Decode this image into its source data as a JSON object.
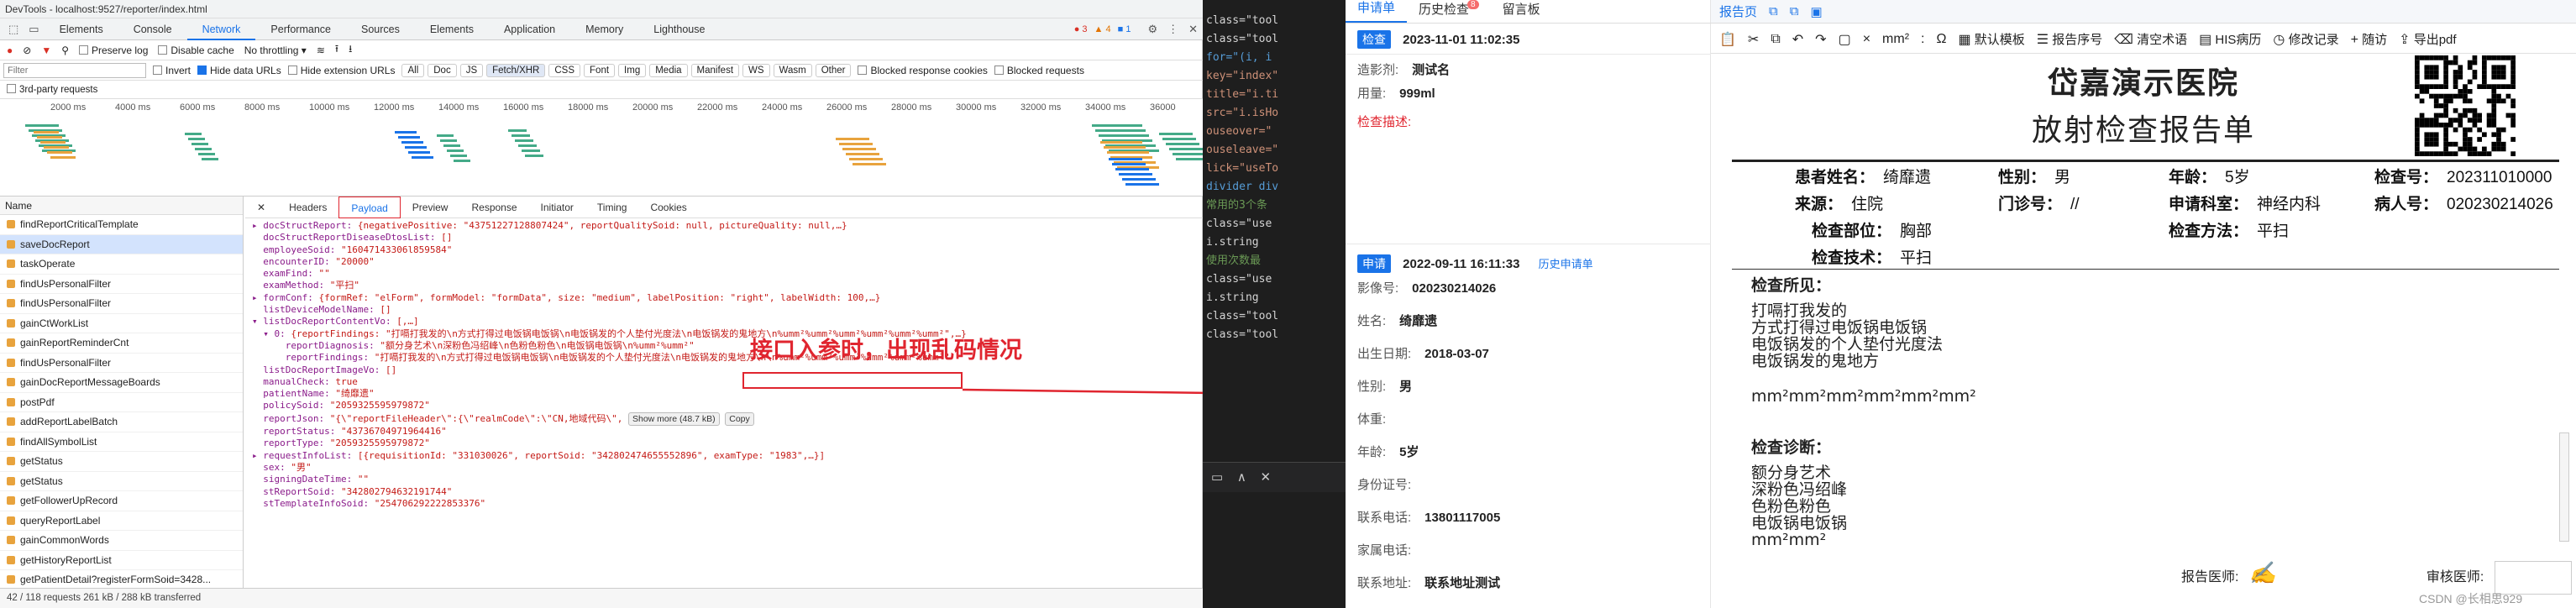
{
  "devtools": {
    "window_title": "DevTools - localhost:9527/reporter/index.html",
    "tabs": [
      "Elements",
      "Console",
      "Network",
      "Performance",
      "Sources",
      "Elements",
      "Application",
      "Memory",
      "Lighthouse"
    ],
    "active_tab": "Network",
    "badges": {
      "errors": "3",
      "warnings": "4",
      "info": "1"
    },
    "toolbar": {
      "preserve_log": "Preserve log",
      "disable_cache": "Disable cache",
      "throttling": "No throttling"
    },
    "filter": {
      "placeholder": "Filter",
      "invert": "Invert",
      "hide_data_urls": "Hide data URLs",
      "hide_ext_urls": "Hide extension URLs",
      "chips": [
        "All",
        "Doc",
        "JS",
        "Fetch/XHR",
        "CSS",
        "Font",
        "Img",
        "Media",
        "Manifest",
        "WS",
        "Wasm",
        "Other"
      ],
      "active_chip": "Fetch/XHR",
      "blocked_cookies": "Blocked response cookies",
      "blocked_requests": "Blocked requests"
    },
    "third_party": "3rd-party requests",
    "timeline_ticks": [
      "2000 ms",
      "4000 ms",
      "6000 ms",
      "8000 ms",
      "10000 ms",
      "12000 ms",
      "14000 ms",
      "16000 ms",
      "18000 ms",
      "20000 ms",
      "22000 ms",
      "24000 ms",
      "26000 ms",
      "28000 ms",
      "30000 ms",
      "32000 ms",
      "34000 ms",
      "36000"
    ],
    "req_header": "Name",
    "requests": [
      "findReportCriticalTemplate",
      "saveDocReport",
      "taskOperate",
      "findUsPersonalFilter",
      "findUsPersonalFilter",
      "gainCtWorkList",
      "gainReportReminderCnt",
      "findUsPersonalFilter",
      "gainDocReportMessageBoards",
      "postPdf",
      "addReportLabelBatch",
      "findAllSymbolList",
      "getStatus",
      "getStatus",
      "getFollowerUpRecord",
      "queryReportLabel",
      "gainCommonWords",
      "getHistoryReportList",
      "getPatientDetail?registerFormSoid=3428..."
    ],
    "selected_request": "saveDocReport",
    "status": "42 / 118 requests   261 kB / 288 kB transferred",
    "detail_tabs": [
      "Headers",
      "Payload",
      "Preview",
      "Response",
      "Initiator",
      "Timing",
      "Cookies"
    ],
    "active_detail_tab": "Payload",
    "payload": [
      [
        "▸ docStructReport: ",
        "{negativePositive: \"43751227128807424\", reportQualitySoid: null, pictureQuality: null,…}"
      ],
      [
        "  docStructReportDiseaseDtosList: ",
        "[]"
      ],
      [
        "  employeeSoid: ",
        "\"16047143306l859584\""
      ],
      [
        "  encounterID: ",
        "\"20000\""
      ],
      [
        "  examFind: ",
        "\"\""
      ],
      [
        "  examMethod: ",
        "\"平扫\""
      ],
      [
        "▸ formConf: ",
        "{formRef: \"elForm\", formModel: \"formData\", size: \"medium\", labelPosition: \"right\", labelWidth: 100,…}"
      ],
      [
        "  listDeviceModelName: ",
        "[]"
      ],
      [
        "▾ listDocReportContentVo: ",
        "[,…]"
      ],
      [
        "  ▾ 0: ",
        "{reportFindings: \"打嗝打我发的\\n方式打得过电饭锅电饭锅\\n电饭锅发的个人垫付光度法\\n电饭锅发的鬼地方\\n%umm²%umm²%umm²%umm²%umm²%umm²\",…}"
      ],
      [
        "      reportDiagnosis: ",
        "\"额分身艺术\\n深粉色冯绍峰\\n色粉色粉色\\n电饭锅电饭锅\\n%umm²%umm²\""
      ],
      [
        "      reportFindings: ",
        "\"打嗝打我发的\\n方式打得过电饭锅电饭锅\\n电饭锅发的个人垫付光度法\\n电饭锅发的鬼地方\\n\\n%umm²%umm²%umm²%umm²%umm²%umm²\""
      ],
      [
        "  listDocReportImageVo: ",
        "[]"
      ],
      [
        "  manualCheck: ",
        "true"
      ],
      [
        "  patientName: ",
        "\"绮靡遗\""
      ],
      [
        "  policySoid: ",
        "\"2059325595979872\""
      ],
      [
        "  reportJson: ",
        "\"{\\\"reportFileHeader\\\":{\\\"realmCode\\\":\\\"CN,地域代码\\\","
      ],
      [
        "  reportStatus: ",
        "\"43736704971964416\""
      ],
      [
        "  reportType: ",
        "\"2059325595979872\""
      ],
      [
        "▸ requestInfoList: ",
        "[{requisitionId: \"331030026\", reportSoid: \"342802474655552896\", examType: \"1983\",…}]"
      ],
      [
        "  sex: ",
        "\"男\""
      ],
      [
        "  signingDateTime: ",
        "\"\""
      ],
      [
        "  stReportSoid: ",
        "\"342802794632191744\""
      ],
      [
        "  stTemplateInfoSoid: ",
        "\"254706292222853376\""
      ]
    ],
    "show_more": "Show more (48.7 kB)",
    "copy": "Copy",
    "annotation": "接口入参时，出现乱码情况"
  },
  "code_lines": [
    "class=\"tool",
    "class=\"tool",
    "for=\"(i, i",
    "key=\"index\"",
    "title=\"i.ti",
    "src=\"i.isHo",
    "ouseover=\"",
    "ouseleave=\"",
    "lick=\"useTo",
    "",
    "divider div",
    "常用的3个条",
    "class=\"use",
    "i.string",
    "",
    "使用次数最",
    "class=\"use",
    "i.string",
    "",
    "class=\"tool",
    "class=\"tool"
  ],
  "code_panel_icons": [
    "▭",
    "∧",
    "✕"
  ],
  "patient": {
    "tabs": [
      "申请单",
      "历史检查",
      "留言板"
    ],
    "history_badge": "8",
    "exam_tag": "检查",
    "exam_time": "2023-11-01 11:02:35",
    "fields1": [
      [
        "造影剂:",
        "测试名"
      ],
      [
        "用量:",
        "999ml"
      ]
    ],
    "exam_desc_label": "检查描述:",
    "apply_tag": "申请",
    "apply_time": "2022-09-11 16:11:33",
    "apply_link": "历史申请单",
    "fields2": [
      [
        "影像号:",
        "020230214026"
      ],
      [
        "姓名:",
        "绮靡遗"
      ],
      [
        "出生日期:",
        "2018-03-07"
      ],
      [
        "性别:",
        "男"
      ],
      [
        "体重:",
        ""
      ],
      [
        "年龄:",
        "5岁"
      ],
      [
        "身份证号:",
        ""
      ],
      [
        "联系电话:",
        "13801117005"
      ],
      [
        "家属电话:",
        ""
      ],
      [
        "联系地址:",
        "联系地址测试"
      ]
    ]
  },
  "report": {
    "tabs": [
      "报告页"
    ],
    "toolbar": [
      "默认模板",
      "报告序号",
      "清空术语",
      "HIS病历",
      "修改记录",
      "随访",
      "导出pdf"
    ],
    "hospital": "岱嘉演示医院",
    "title": "放射检查报告单",
    "info": [
      [
        [
          "患者姓名：",
          "绮靡遗"
        ],
        [
          "性别：",
          "男"
        ],
        [
          "年龄：",
          "5岁"
        ],
        [
          "检查号：",
          "202311010000"
        ]
      ],
      [
        [
          "来源：",
          "住院"
        ],
        [
          "门诊号：",
          "//"
        ],
        [
          "申请科室：",
          "神经内科"
        ],
        [
          "病人号：",
          "020230214026"
        ]
      ],
      [
        [
          "检查部位：",
          "胸部"
        ],
        [
          "",
          ""
        ],
        [
          "检查方法：",
          "平扫"
        ],
        [
          "",
          ""
        ]
      ],
      [
        [
          "检查技术：",
          "平扫"
        ]
      ]
    ],
    "findings_title": "检查所见：",
    "findings": [
      "打嗝打我发的",
      "方式打得过电饭锅电饭锅",
      "电饭锅发的个人垫付光度法",
      "电饭锅发的鬼地方"
    ],
    "garbled": "mm²mm²mm²mm²mm²mm²",
    "diagnosis_title": "检查诊断：",
    "diagnosis": [
      "额分身艺术",
      "深粉色冯绍峰",
      "色粉色粉色",
      "电饭锅电饭锅",
      "mm²mm²"
    ],
    "reporter_label": "报告医师:",
    "reviewer_label": "审核医师:",
    "watermark": "CSDN @长相思929"
  },
  "colors": {
    "accent": "#1a73e8",
    "annotation": "#e0252f"
  }
}
